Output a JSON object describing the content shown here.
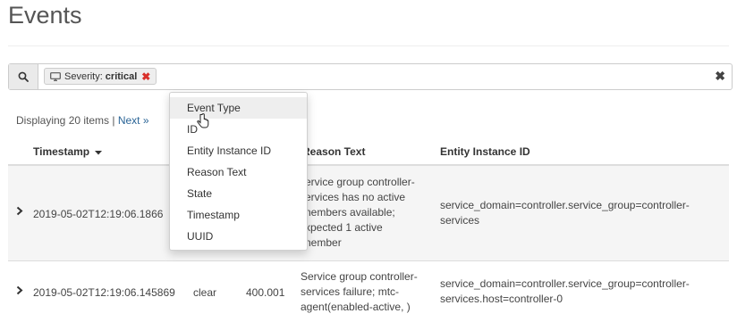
{
  "page": {
    "title": "Events"
  },
  "search": {
    "facet_label": "Severity:",
    "facet_value": "critical",
    "facet_remove": "✖",
    "clear": "✖"
  },
  "summary": {
    "text": "Displaying 20 items | ",
    "next": "Next »"
  },
  "table": {
    "columns": [
      "Timestamp",
      "Reason Text",
      "Entity Instance ID"
    ],
    "rows": [
      {
        "timestamp": "2019-05-02T12:19:06.1866",
        "reason_lines": [
          "ervice group controller-",
          "ervices has no active",
          "nembers available;",
          "xpected 1 active",
          "nember"
        ],
        "entity_lines": [
          "service_domain=controller.service_group=controller-",
          "services"
        ]
      },
      {
        "timestamp": "2019-05-02T12:19:06.145869",
        "state": "clear",
        "id": "400.001",
        "reason_lines": [
          "Service group controller-",
          "services failure; mtc-",
          "agent(enabled-active, )"
        ],
        "entity_lines": [
          "service_domain=controller.service_group=controller-",
          "services.host=controller-0"
        ]
      }
    ]
  },
  "dropdown": {
    "items": [
      "Event Type",
      "ID",
      "Entity Instance ID",
      "Reason Text",
      "State",
      "Timestamp",
      "UUID"
    ]
  },
  "icons": {
    "search": "search-icon",
    "monitor": "monitor-icon",
    "sort": "caret-down-icon",
    "expand": "chevron-right-icon"
  }
}
